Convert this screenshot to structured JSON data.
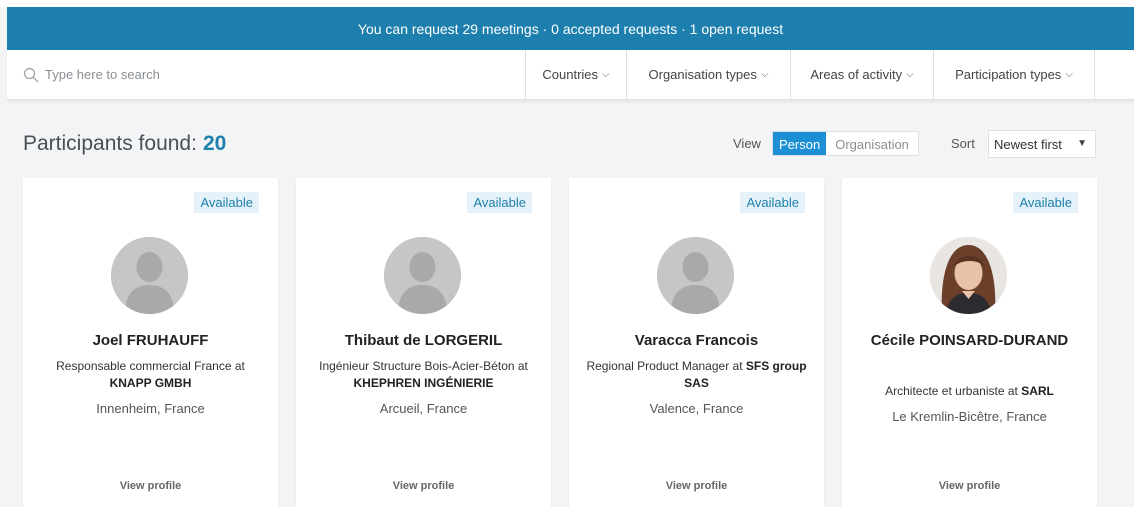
{
  "banner": {
    "text": "You can request 29 meetings · 0 accepted requests · 1 open request"
  },
  "search": {
    "placeholder": "Type here to search"
  },
  "filters": [
    {
      "label": "Countries"
    },
    {
      "label": "Organisation types"
    },
    {
      "label": "Areas of activity"
    },
    {
      "label": "Participation types"
    }
  ],
  "results": {
    "label": "Participants found:",
    "count": "20"
  },
  "view": {
    "label": "View",
    "options": [
      "Person",
      "Organisation"
    ],
    "selected": "Person"
  },
  "sort": {
    "label": "Sort",
    "value": "Newest first"
  },
  "participants": [
    {
      "status": "Available",
      "name": "Joel FRUHAUFF",
      "role": "Responsable commercial France at",
      "company": "KNAPP GMBH",
      "location": "Innenheim, France",
      "link": "View profile"
    },
    {
      "status": "Available",
      "name": "Thibaut de LORGERIL",
      "role": "Ingénieur Structure Bois-Acier-Béton at",
      "company": "KHEPHREN INGÉNIERIE",
      "location": "Arcueil, France",
      "link": "View profile"
    },
    {
      "status": "Available",
      "name": "Varacca Francois",
      "role": "Regional Product Manager at",
      "company": "SFS group SAS",
      "location": "Valence, France",
      "link": "View profile"
    },
    {
      "status": "Available",
      "name": "Cécile POINSARD-DURAND",
      "role": "Architecte et urbaniste at",
      "company": "SARL",
      "location": "Le Kremlin-Bicêtre, France",
      "link": "View profile"
    }
  ],
  "colors": {
    "accent": "#1d7fad",
    "toggle_active": "#1d8fd4",
    "badge_bg": "#e6f2f9"
  },
  "icons": {
    "search": "search-icon",
    "dropdown": "chevron-down-icon",
    "avatar": "user-silhouette-icon"
  }
}
